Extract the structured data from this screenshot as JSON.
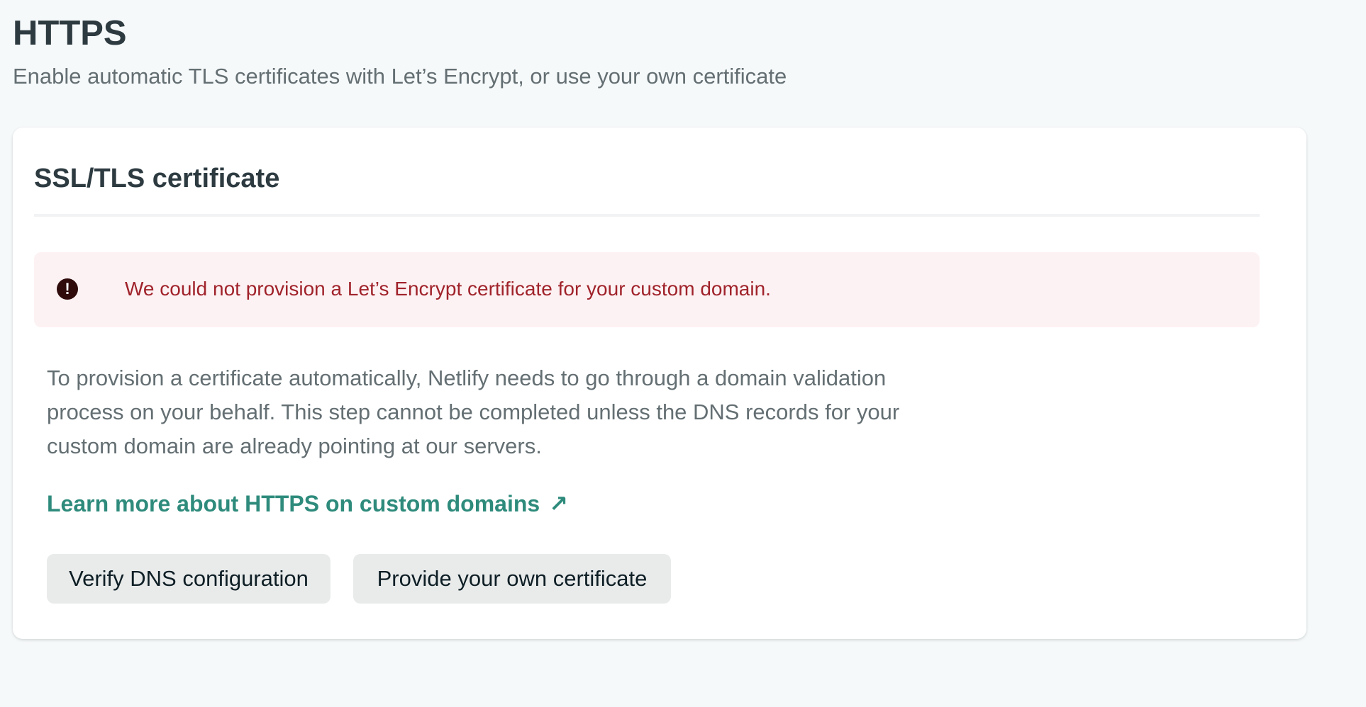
{
  "header": {
    "title": "HTTPS",
    "subtitle": "Enable automatic TLS certificates with Let’s Encrypt, or use your own certificate"
  },
  "card": {
    "title": "SSL/TLS certificate",
    "alert": {
      "icon": "exclamation-circle-icon",
      "icon_glyph": "!",
      "message": "We could not provision a Let’s Encrypt certificate for your custom domain.",
      "text_color": "#a0232b",
      "background_color": "#fdf2f3"
    },
    "description": "To provision a certificate automatically, Netlify needs to go through a domain validation process on your behalf. This step cannot be completed unless the DNS records for your custom domain are already pointing at our servers.",
    "learn_more": {
      "label": "Learn more about HTTPS on custom domains",
      "icon": "external-arrow-icon",
      "icon_glyph": "↗",
      "color": "#2e8b7c"
    },
    "buttons": {
      "verify_dns": "Verify DNS configuration",
      "own_certificate": "Provide your own certificate"
    }
  }
}
